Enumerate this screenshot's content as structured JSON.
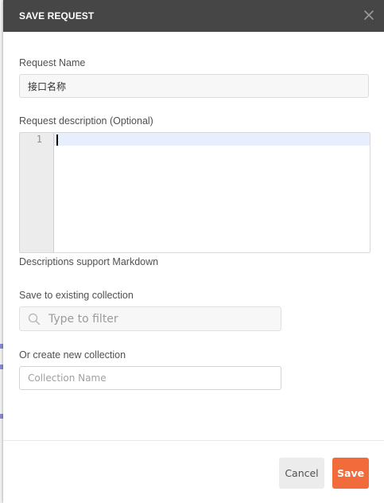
{
  "dialog": {
    "title": "SAVE REQUEST",
    "close_icon": "close-icon"
  },
  "request_name": {
    "label": "Request Name",
    "value": "接口名称"
  },
  "description": {
    "label": "Request description (Optional)",
    "line_number": "1",
    "hint": "Descriptions support Markdown"
  },
  "existing_collection": {
    "label": "Save to existing collection",
    "search_icon": "search-icon",
    "placeholder": "Type to filter"
  },
  "new_collection": {
    "label": "Or create new collection",
    "placeholder": "Collection Name"
  },
  "footer": {
    "cancel_label": "Cancel",
    "save_label": "Save"
  },
  "colors": {
    "header_bg": "#464646",
    "save_button": "#f26b3a",
    "cancel_button": "#ececec",
    "active_line": "#e6effb"
  }
}
